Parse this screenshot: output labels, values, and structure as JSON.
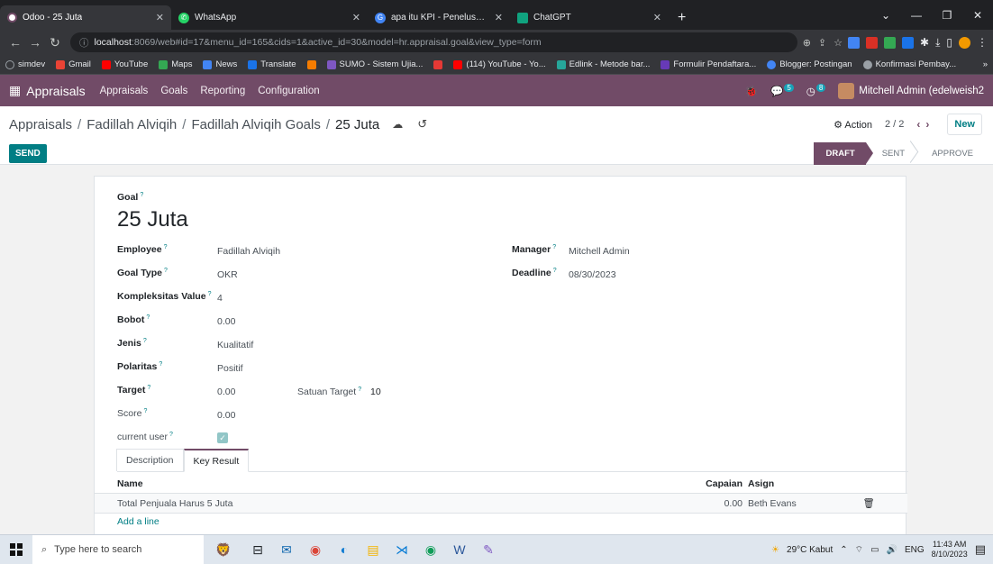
{
  "browser": {
    "tabs": [
      {
        "label": "Odoo - 25 Juta",
        "icon": "odoo-icon",
        "color": "#714b67",
        "active": true
      },
      {
        "label": "WhatsApp",
        "icon": "whatsapp-icon",
        "color": "#25d366"
      },
      {
        "label": "apa itu KPI - Penelusuran Google",
        "icon": "google-icon",
        "color": "#4285f4"
      },
      {
        "label": "ChatGPT",
        "icon": "chatgpt-icon",
        "color": "#10a37f"
      }
    ],
    "new_tab": "+",
    "url_host": "localhost",
    "url_rest": ":8069/web#id=17&menu_id=165&cids=1&active_id=30&model=hr.appraisal.goal&view_type=form",
    "bookmarks": [
      "simdev",
      "Gmail",
      "YouTube",
      "Maps",
      "News",
      "Translate",
      "",
      "SUMO - Sistem Ujia...",
      "",
      "(114) YouTube - Yo...",
      "Edlink - Metode bar...",
      "Formulir Pendaftara...",
      "Blogger: Postingan",
      "Konfirmasi Pembay..."
    ],
    "bookmarks_more": "»"
  },
  "odoo_nav": {
    "brand": "Appraisals",
    "menus": [
      "Appraisals",
      "Goals",
      "Reporting",
      "Configuration"
    ],
    "messages_count": "5",
    "activities_count": "8",
    "user": "Mitchell Admin (edelweish2"
  },
  "breadcrumb": {
    "items": [
      "Appraisals",
      "Fadillah Alviqih",
      "Fadillah Alviqih Goals"
    ],
    "current": "25 Juta"
  },
  "control": {
    "action": "Action",
    "pager": "2 / 2",
    "new": "New"
  },
  "status": {
    "send": "SEND",
    "stages": [
      "DRAFT",
      "SENT",
      "APPROVE"
    ],
    "active_stage": "DRAFT"
  },
  "form": {
    "goal_label": "Goal",
    "goal_name": "25 Juta",
    "employee_label": "Employee",
    "employee": "Fadillah Alviqih",
    "goal_type_label": "Goal Type",
    "goal_type": "OKR",
    "kompleksitas_label": "Kompleksitas Value",
    "kompleksitas": "4",
    "bobot_label": "Bobot",
    "bobot": "0.00",
    "jenis_label": "Jenis",
    "jenis": "Kualitatif",
    "polaritas_label": "Polaritas",
    "polaritas": "Positif",
    "target_label": "Target",
    "target": "0.00",
    "satuan_label": "Satuan Target",
    "satuan": "10",
    "score_label": "Score",
    "score": "0.00",
    "current_user_label": "current user",
    "current_user": true,
    "manager_label": "Manager",
    "manager": "Mitchell Admin",
    "deadline_label": "Deadline",
    "deadline": "08/30/2023",
    "help": "?"
  },
  "notebook": {
    "tabs": [
      "Description",
      "Key Result"
    ],
    "active": "Key Result",
    "columns": [
      "Name",
      "Capaian",
      "Asign"
    ],
    "rows": [
      {
        "name": "Total Penjuala Harus 5 Juta",
        "capaian": "0.00",
        "asign": "Beth Evans"
      }
    ],
    "add_line": "Add a line"
  },
  "taskbar": {
    "search_placeholder": "Type here to search",
    "weather": "29°C Kabut",
    "lang": "ENG",
    "time": "11:43 AM",
    "date": "8/10/2023"
  }
}
